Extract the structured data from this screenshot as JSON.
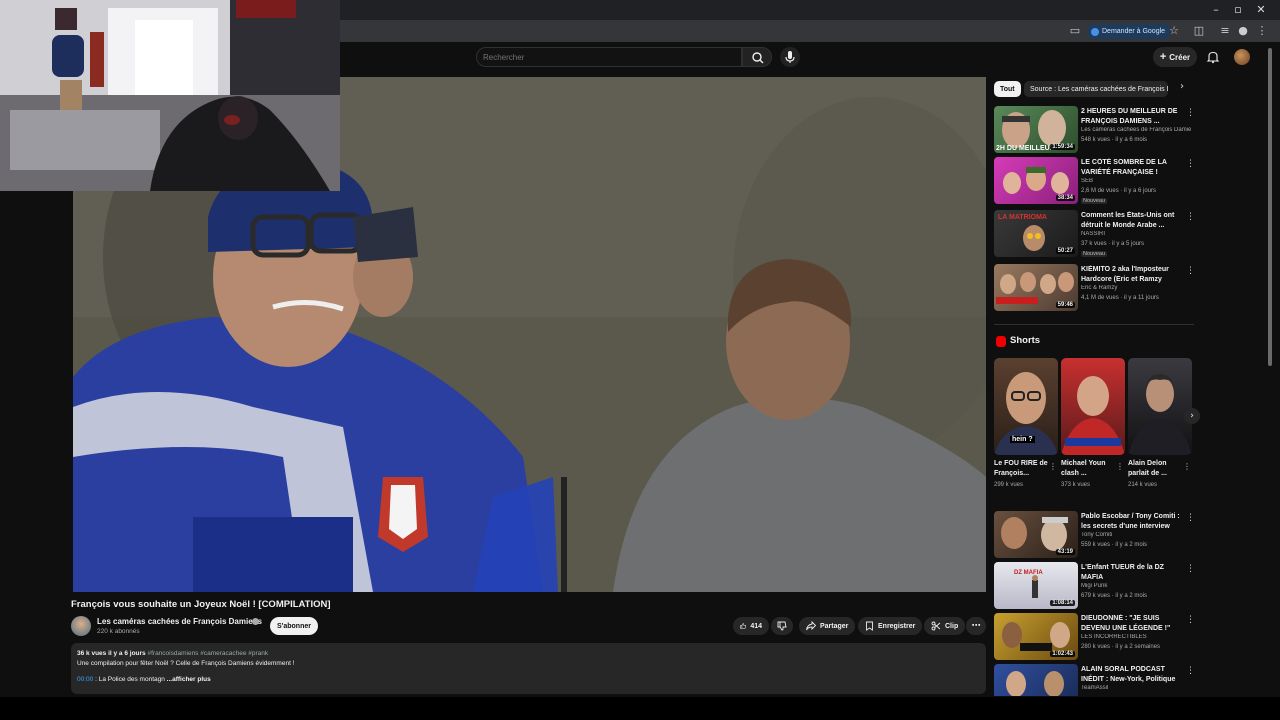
{
  "browser": {
    "google_chip": "Demander à Google",
    "colors": {
      "chrome": "#202124",
      "address_bar": "#35363a"
    }
  },
  "header": {
    "search_placeholder": "Rechercher",
    "create_label": "Créer"
  },
  "video": {
    "title": "François vous souhaite un Joyeux Noël ! [COMPILATION]",
    "channel_name": "Les caméras cachées de François Damiens",
    "subscribers": "220 k abonnés",
    "subscribe_label": "S'abonner",
    "likes": "414",
    "share_label": "Partager",
    "save_label": "Enregistrer",
    "clip_label": "Clip",
    "description": {
      "views": "36 k vues",
      "age": "il y a 6 jours",
      "tags": "#francoisdamiens #cameracachee #prank",
      "line": "Une compilation pour fêter Noël ? Celle de François Damiens évidemment !",
      "timestamp": "00:00",
      "chapter": "La Police des montagn",
      "more": "...afficher plus"
    }
  },
  "sidebar": {
    "chips": [
      "Tout",
      "Source : Les caméras cachées de François Damiens"
    ],
    "recommendations_top": [
      {
        "title": "2 HEURES DU MEILLEUR DE FRANÇOIS DAMIENS ...",
        "channel": "Les caméras cachées de François Damiens",
        "meta": "548 k vues · il y a 6 mois",
        "duration": "1:59:34",
        "badge": ""
      },
      {
        "title": "LE CÔTÉ SOMBRE DE LA VARIÉTÉ FRANÇAISE !",
        "channel": "SEB",
        "meta": "2,6 M de vues · il y a 6 jours",
        "duration": "38:34",
        "badge": "Nouveau"
      },
      {
        "title": "Comment les États-Unis ont détruit le Monde Arabe ...",
        "channel": "NASSIRI",
        "meta": "37 k vues · il y a 5 jours",
        "duration": "50:27",
        "badge": "Nouveau"
      },
      {
        "title": "KIÉMITO 2 aka l'Imposteur Hardcore (Eric et Ramzy invite...",
        "channel": "Eric & Ramzy",
        "meta": "4,1 M de vues · il y a 11 jours",
        "duration": "59:46",
        "badge": ""
      }
    ],
    "shorts_title": "Shorts",
    "shorts": [
      {
        "title": "Le FOU RIRE de François...",
        "views": "299 k vues",
        "overlay": "hein ?"
      },
      {
        "title": "Michael Youn clash ...",
        "views": "373 k vues",
        "overlay": ""
      },
      {
        "title": "Alain Delon parlait de ...",
        "views": "214 k vues",
        "overlay": ""
      }
    ],
    "recommendations_bottom": [
      {
        "title": "Pablo Escobar / Tony Comiti : les secrets d'une interview choc",
        "channel": "Tony Comiti",
        "meta": "559 k vues · il y a 2 mois",
        "duration": "43:19"
      },
      {
        "title": "L'Enfant TUEUR de la DZ MAFIA",
        "channel": "Migi Punk",
        "meta": "679 k vues · il y a 2 mois",
        "duration": "1:08:14"
      },
      {
        "title": "DIEUDONNÉ : \"JE SUIS DEVENU UNE LÉGENDE !\"",
        "channel": "LES INCORRECTIBLES",
        "meta": "280 k vues · il y a 2 semaines",
        "duration": "1:02:43"
      },
      {
        "title": "ALAIN SORAL PODCAST INÉDIT : New-York, Politique Françals...",
        "channel": "TeamAssil",
        "meta": "",
        "duration": ""
      }
    ]
  },
  "icons": {
    "back": "arrow-left-icon",
    "search": "search-icon",
    "mic": "microphone-icon",
    "bell": "bell-icon",
    "like": "thumbs-up-icon",
    "dislike": "thumbs-down-icon",
    "share": "share-icon",
    "save": "bookmark-icon",
    "clip": "scissors-icon",
    "more": "kebab-icon"
  }
}
